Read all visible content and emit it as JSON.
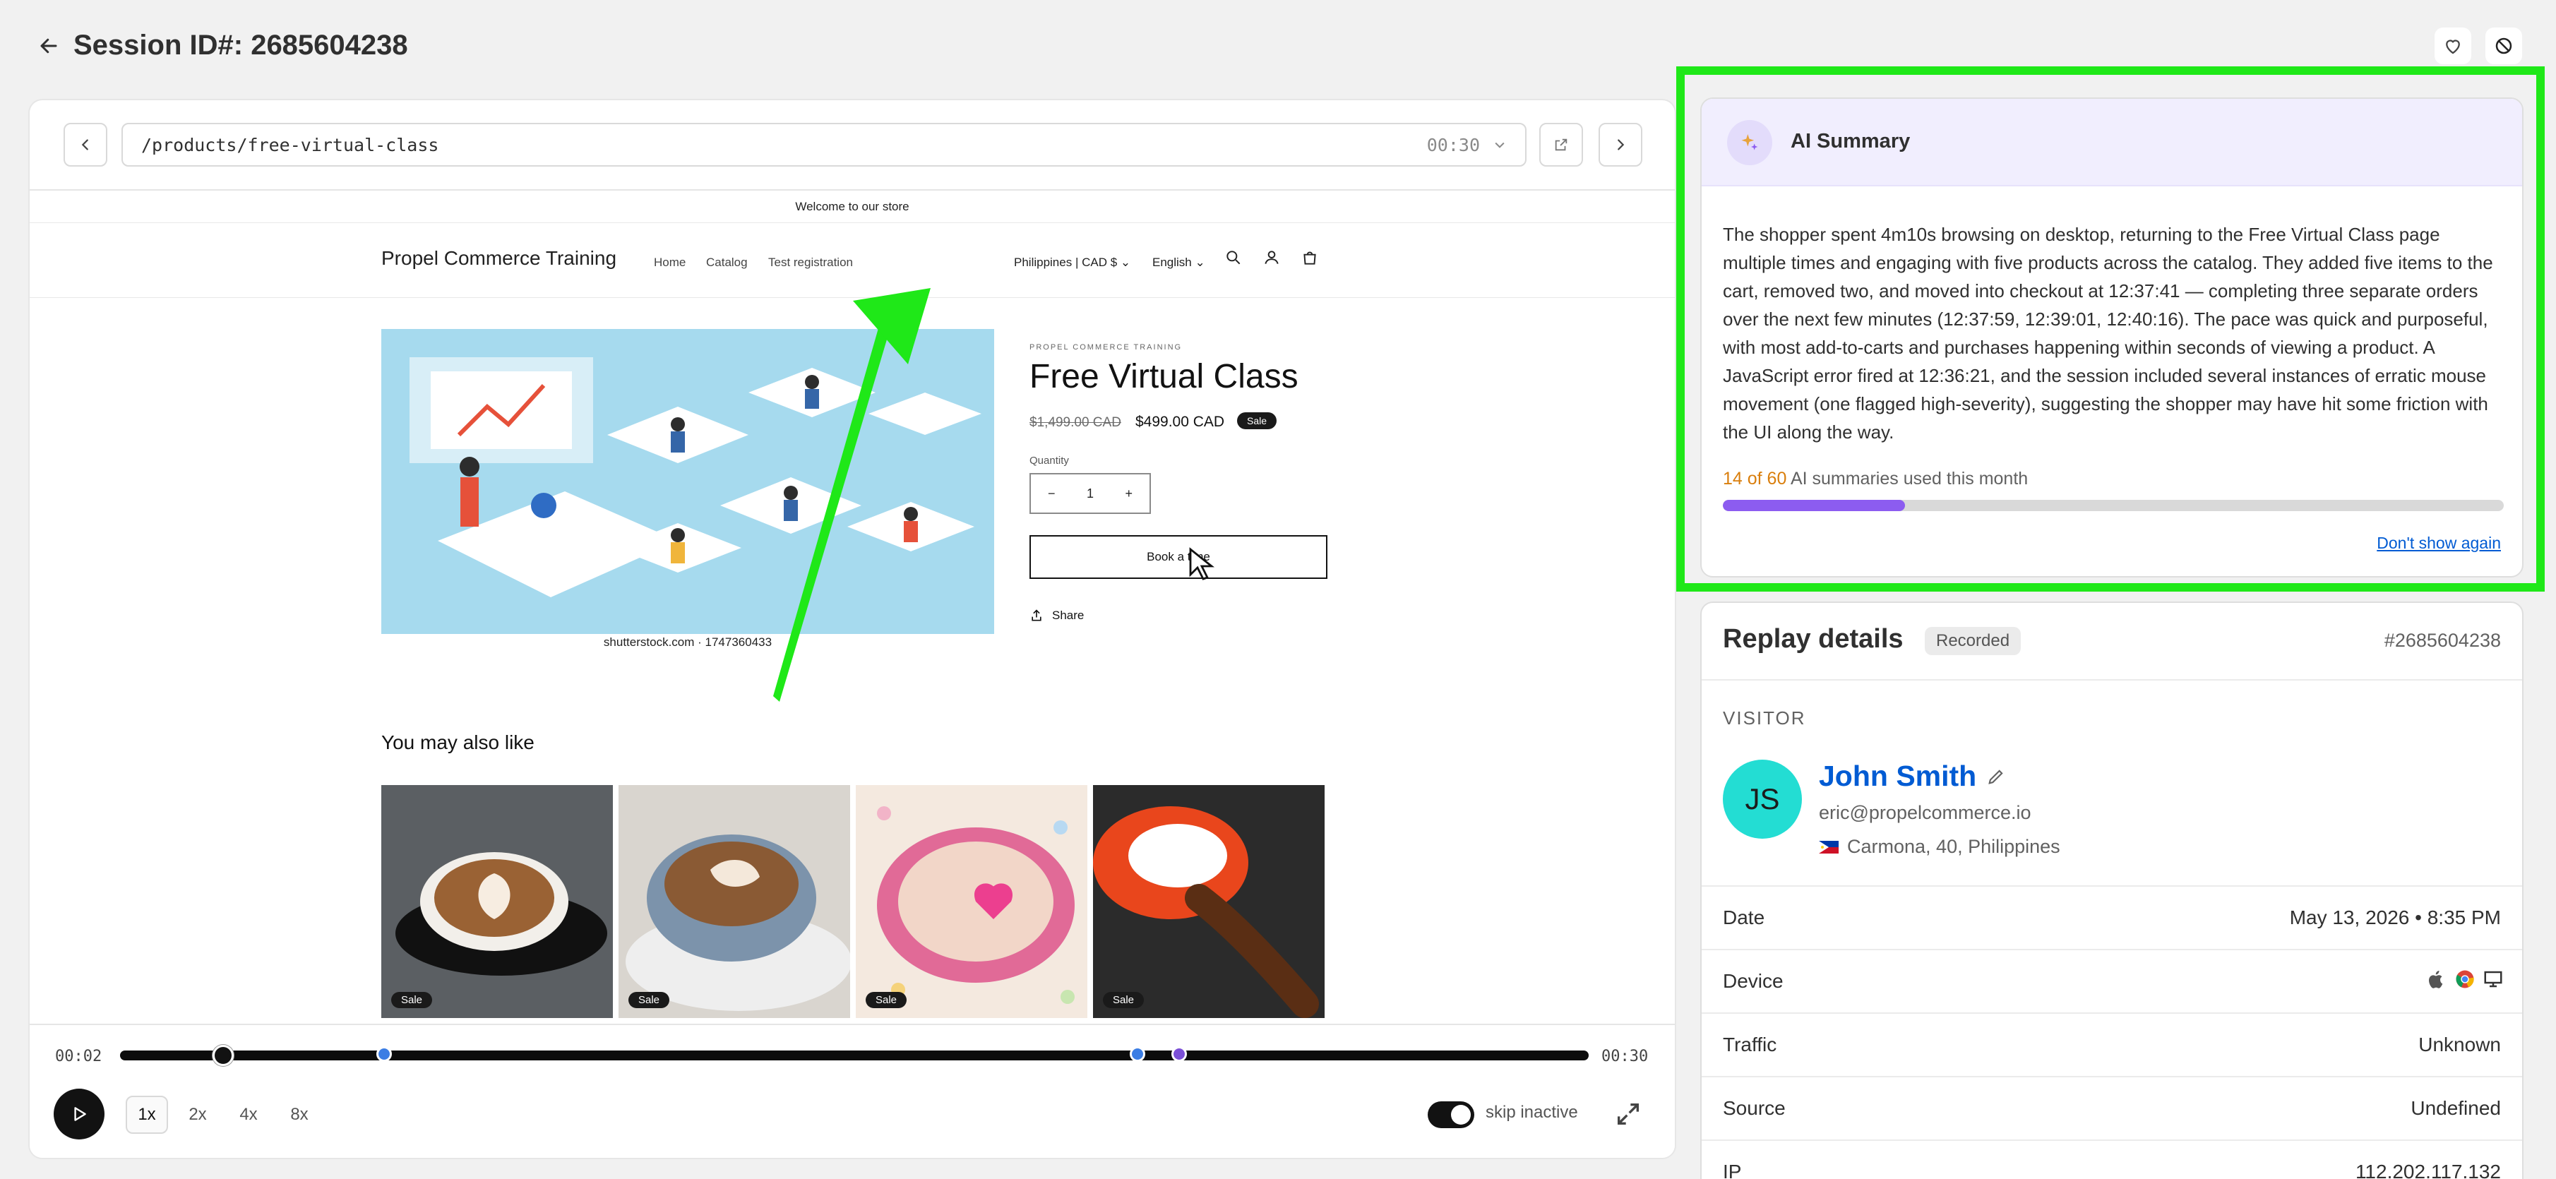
{
  "header": {
    "title": "Session ID#: 2685604238",
    "back_icon": "arrow-left-icon",
    "actions": [
      "heart-icon",
      "block-icon"
    ]
  },
  "player": {
    "url_path": "/products/free-virtual-class",
    "url_time": "00:30",
    "store": {
      "announcement": "Welcome to our store",
      "brand": "Propel Commerce Training",
      "nav": [
        "Home",
        "Catalog",
        "Test registration"
      ],
      "locale": "Philippines | CAD $",
      "language": "English",
      "image_credit": "shutterstock.com · 1747360433",
      "vendor": "PROPEL COMMERCE TRAINING",
      "product_title": "Free Virtual Class",
      "compare_price": "$1,499.00 CAD",
      "price": "$499.00 CAD",
      "sale_badge": "Sale",
      "quantity_label": "Quantity",
      "quantity_value": "1",
      "qty_minus": "−",
      "qty_plus": "+",
      "book_button": "Book a time",
      "share": "Share",
      "related_title": "You may also like",
      "related_badges": [
        "Sale",
        "Sale",
        "Sale",
        "Sale"
      ]
    },
    "controls": {
      "time_current": "00:02",
      "time_total": "00:30",
      "progress": 0.07,
      "event_markers": [
        0.18,
        0.693,
        0.721
      ],
      "speeds": [
        "1x",
        "2x",
        "4x",
        "8x"
      ],
      "active_speed": "1x",
      "skip_inactive_label": "skip inactive",
      "skip_inactive": true
    }
  },
  "ai_summary": {
    "title": "AI Summary",
    "text": "The shopper spent 4m10s browsing on desktop, returning to the Free Virtual Class page multiple times and engaging with five products across the catalog. They added five items to the cart, removed two, and moved into checkout at 12:37:41 — completing three separate orders over the next few minutes (12:37:59, 12:39:01, 12:40:16). The pace was quick and purposeful, with most add-to-carts and purchases happening within seconds of viewing a product. A JavaScript error fired at 12:36:21, and the session included several instances of erratic mouse movement (one flagged high-severity), suggesting the shopper may have hit some friction with the UI along the way.",
    "usage_count": "14 of 60",
    "usage_text": "AI summaries used this month",
    "usage_fraction": 0.233,
    "dont_show": "Don't show again",
    "highlight_color": "#1fe818",
    "accent": "#8c5cf0"
  },
  "details": {
    "title": "Replay details",
    "badge": "Recorded",
    "session_ref": "#2685604238",
    "visitor_label": "VISITOR",
    "visitor": {
      "initials": "JS",
      "name": "John Smith",
      "email": "eric@propelcommerce.io",
      "location": "Carmona, 40, Philippines"
    },
    "rows": [
      {
        "label": "Date",
        "value": "May 13, 2026 • 8:35 PM"
      },
      {
        "label": "Device",
        "value": ""
      },
      {
        "label": "Traffic",
        "value": "Unknown"
      },
      {
        "label": "Source",
        "value": "Undefined"
      },
      {
        "label": "IP",
        "value": "112.202.117.132"
      }
    ]
  }
}
